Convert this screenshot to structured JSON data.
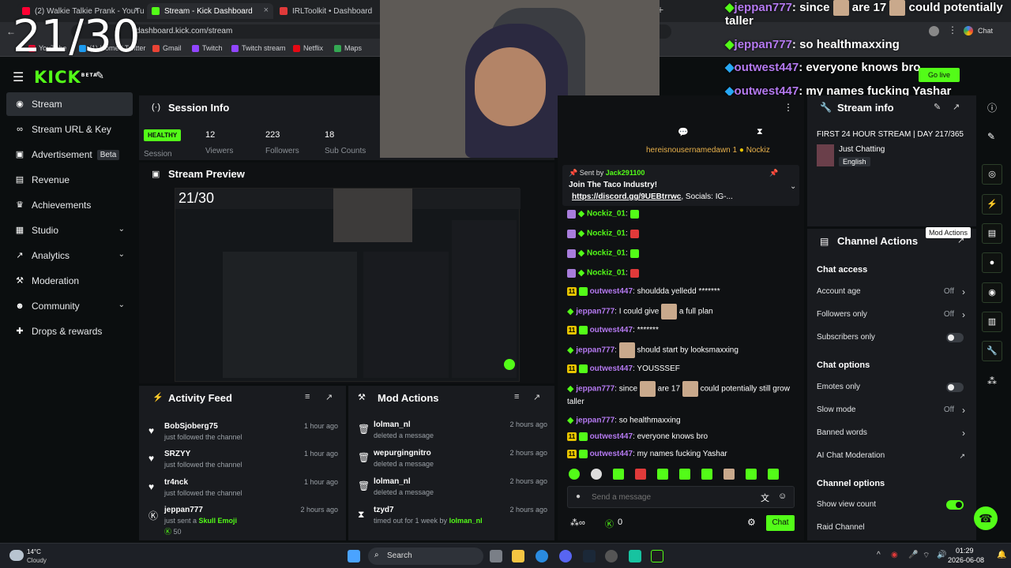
{
  "overlay": {
    "counter": "21/30"
  },
  "browser": {
    "tabs": [
      {
        "label": "(2) Walkie Talkie Prank - YouTube",
        "color": "#ff0033"
      },
      {
        "label": "Stream - Kick Dashboard",
        "color": "#53fc18"
      },
      {
        "label": "IRLToolkit • Dashboard",
        "color": "#e03a3a"
      }
    ],
    "url": "dashboard.kick.com/stream",
    "bookmarks": [
      "YouTube",
      "(1) Home / Twitter",
      "Gmail",
      "Twitch",
      "Twitch stream",
      "Netflix",
      "Maps"
    ],
    "chat_label": "Chat"
  },
  "overlay_chat": [
    {
      "user": "jeppan777",
      "text": "since",
      "text2": "are 17",
      "text3": "could potentially",
      "text4": "taller"
    },
    {
      "user": "jeppan777",
      "text": "so healthmaxxing"
    },
    {
      "user": "outwest447",
      "text": "everyone knows bro"
    },
    {
      "user": "outwest447",
      "text": "my names fucking Yashar"
    }
  ],
  "header": {
    "logo": "KICK",
    "logo_beta": "BETA",
    "go_live": "Go live"
  },
  "sidebar": {
    "items": [
      {
        "label": "Stream",
        "icon": "broadcast-icon"
      },
      {
        "label": "Stream URL & Key",
        "icon": "link-icon"
      },
      {
        "label": "Advertisement",
        "badge": "Beta",
        "icon": "ad-icon"
      },
      {
        "label": "Revenue",
        "icon": "revenue-icon"
      },
      {
        "label": "Achievements",
        "icon": "trophy-icon"
      },
      {
        "label": "Studio",
        "icon": "studio-icon",
        "chevron": true
      },
      {
        "label": "Analytics",
        "icon": "analytics-icon",
        "chevron": true
      },
      {
        "label": "Moderation",
        "icon": "hammer-icon"
      },
      {
        "label": "Community",
        "icon": "community-icon",
        "chevron": true
      },
      {
        "label": "Drops & rewards",
        "icon": "gift-icon"
      }
    ]
  },
  "session": {
    "title": "Session Info",
    "status": "HEALTHY",
    "status_label": "Session",
    "stats": [
      {
        "value": "12",
        "label": "Viewers"
      },
      {
        "value": "223",
        "label": "Followers"
      },
      {
        "value": "18",
        "label": "Sub Counts"
      }
    ]
  },
  "preview": {
    "title": "Stream Preview",
    "counter": "21/30"
  },
  "activity": {
    "title": "Activity Feed",
    "items": [
      {
        "name": "BobSjoberg75",
        "sub": "just followed the channel",
        "time": "1 hour ago",
        "icon": "heart-icon"
      },
      {
        "name": "SRZYY",
        "sub": "just followed the channel",
        "time": "1 hour ago",
        "icon": "heart-icon"
      },
      {
        "name": "tr4nck",
        "sub": "just followed the channel",
        "time": "1 hour ago",
        "icon": "heart-icon"
      },
      {
        "name": "jeppan777",
        "sub": "just sent a",
        "gift": "Skull Emoji",
        "time": "2 hours ago",
        "icon": "kick-coin-icon",
        "amount": "50"
      }
    ]
  },
  "mod": {
    "title": "Mod Actions",
    "items": [
      {
        "name": "lolman_nl",
        "sub": "deleted a message",
        "time": "2 hours ago",
        "icon": "trash-icon"
      },
      {
        "name": "wepurgingnitro",
        "sub": "deleted a message",
        "time": "2 hours ago",
        "icon": "trash-icon"
      },
      {
        "name": "lolman_nl",
        "sub": "deleted a message",
        "time": "2 hours ago",
        "icon": "trash-icon"
      },
      {
        "name": "tzyd7",
        "sub": "timed out for 1 week by",
        "by": "lolman_nl",
        "time": "2 hours ago",
        "icon": "hourglass-icon"
      }
    ]
  },
  "chat": {
    "top_user": "hereisnousernamedawn",
    "top_amount": "1",
    "top_user2": "Nockiz",
    "pinned": {
      "sent_by": "Sent by",
      "user": "Jack291100",
      "line1": "Join The Taco Industry!",
      "link": "https://discord.gg/9UEBtrrwc",
      "line2": ", Socials: IG-..."
    },
    "messages": [
      {
        "user": "Nockiz_01",
        "type": "emote",
        "style": "p"
      },
      {
        "user": "Nockiz_01",
        "type": "emote",
        "style": "p"
      },
      {
        "user": "Nockiz_01",
        "type": "emote",
        "style": "p"
      },
      {
        "user": "Nockiz_01",
        "type": "emote",
        "style": "p"
      },
      {
        "user": "outwest447",
        "text": "shouldda yelledd *******",
        "style": "o"
      },
      {
        "user": "jeppan777",
        "text": "I could give",
        "text2": "a full plan",
        "style": "j"
      },
      {
        "user": "outwest447",
        "text": "*******",
        "style": "o"
      },
      {
        "user": "jeppan777",
        "text": "",
        "text2": "should start by looksmaxxing",
        "style": "j"
      },
      {
        "user": "outwest447",
        "text": "YOUSSSEF",
        "style": "o"
      },
      {
        "user": "jeppan777",
        "text": "since",
        "text2": "are 17",
        "text3": "could potentially still grow taller",
        "style": "j"
      },
      {
        "user": "jeppan777",
        "text": "so healthmaxxing",
        "style": "j"
      },
      {
        "user": "outwest447",
        "text": "everyone knows bro",
        "style": "o"
      },
      {
        "user": "outwest447",
        "text": "my names fucking Yashar",
        "style": "o"
      }
    ],
    "placeholder": "Send a message",
    "points": "0",
    "send_label": "Chat"
  },
  "stream_info": {
    "title": "Stream info",
    "stream_title": "FIRST 24 HOUR STREAM | DAY 217/365",
    "category": "Just Chatting",
    "tag": "English"
  },
  "channel_actions": {
    "title": "Channel Actions",
    "tooltip": "Mod Actions",
    "chat_access": "Chat access",
    "access_rows": [
      {
        "label": "Account age",
        "value": "Off",
        "kind": "arrow"
      },
      {
        "label": "Followers only",
        "value": "Off",
        "kind": "arrow"
      },
      {
        "label": "Subscribers only",
        "kind": "toggle",
        "on": false
      }
    ],
    "chat_options": "Chat options",
    "option_rows": [
      {
        "label": "Emotes only",
        "kind": "toggle",
        "on": false
      },
      {
        "label": "Slow mode",
        "value": "Off",
        "kind": "arrow"
      },
      {
        "label": "Banned words",
        "kind": "arrow"
      },
      {
        "label": "AI Chat Moderation",
        "kind": "external"
      }
    ],
    "channel_options": "Channel options",
    "channel_rows": [
      {
        "label": "Show view count",
        "kind": "toggle",
        "on": true
      },
      {
        "label": "Raid Channel",
        "kind": "none"
      }
    ]
  },
  "taskbar": {
    "temp": "14°C",
    "weather": "Cloudy",
    "search": "Search",
    "time": "01:29",
    "date": "2026-06-08"
  }
}
